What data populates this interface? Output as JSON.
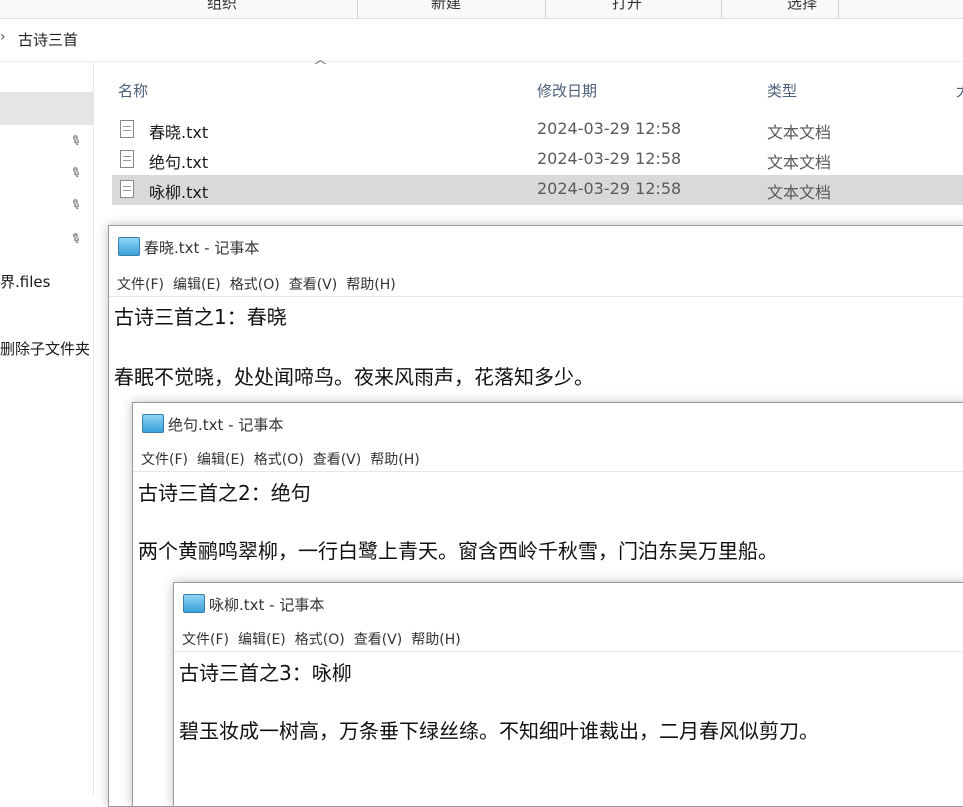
{
  "ribbon": {
    "items": [
      "组织",
      "新建",
      "打开",
      "选择"
    ]
  },
  "address": {
    "crumb": "古诗三首"
  },
  "nav": {
    "files_label": "界.files",
    "delete_label": "删除子文件夹"
  },
  "columns": {
    "name": "名称",
    "date": "修改日期",
    "type": "类型",
    "size": "大"
  },
  "files": [
    {
      "name": "春晓.txt",
      "date": "2024-03-29 12:58",
      "type": "文本文档"
    },
    {
      "name": "绝句.txt",
      "date": "2024-03-29 12:58",
      "type": "文本文档"
    },
    {
      "name": "咏柳.txt",
      "date": "2024-03-29 12:58",
      "type": "文本文档"
    }
  ],
  "menu": [
    "文件(F)",
    "编辑(E)",
    "格式(O)",
    "查看(V)",
    "帮助(H)"
  ],
  "notepads": [
    {
      "title": "春晓.txt - 记事本",
      "line1": "古诗三首之1：春晓",
      "line2": "春眠不觉晓，处处闻啼鸟。夜来风雨声，花落知多少。"
    },
    {
      "title": "绝句.txt - 记事本",
      "line1": "古诗三首之2：绝句",
      "line2": "两个黄鹂鸣翠柳，一行白鹭上青天。窗含西岭千秋雪，门泊东吴万里船。"
    },
    {
      "title": "咏柳.txt - 记事本",
      "line1": "古诗三首之3：咏柳",
      "line2": "碧玉妆成一树高，万条垂下绿丝绦。不知细叶谁裁出，二月春风似剪刀。"
    }
  ]
}
